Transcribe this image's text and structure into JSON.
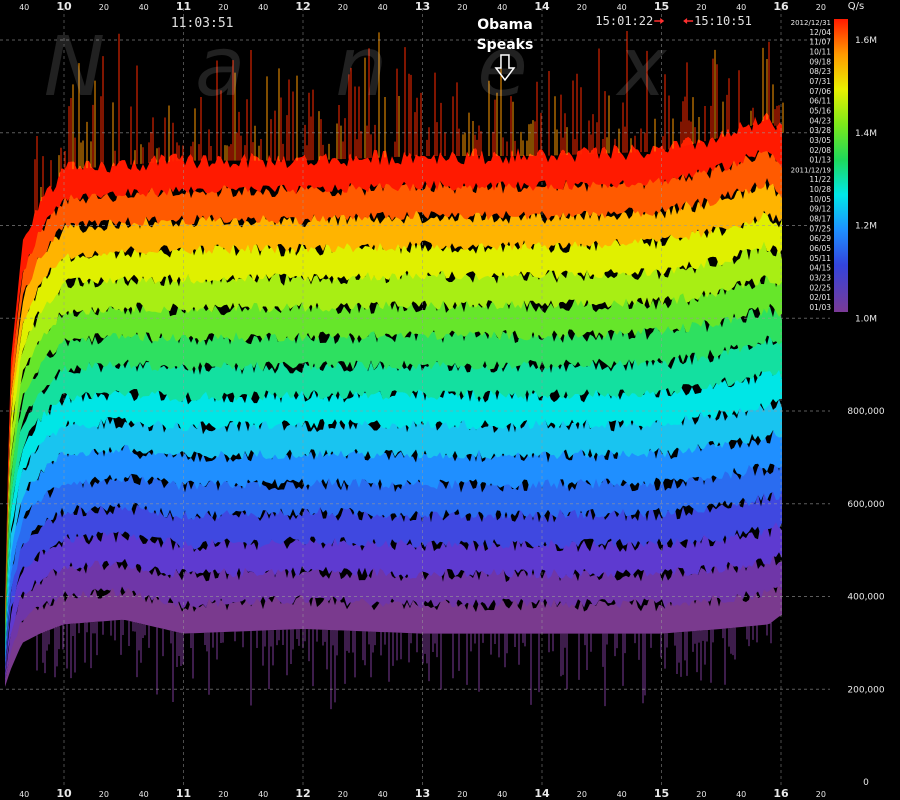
{
  "chart_data": {
    "type": "area",
    "title": "",
    "xlabel": "",
    "ylabel": "",
    "y_unit": "Q/s",
    "watermark": "Nanex",
    "xlim": [
      9.5,
      16.5
    ],
    "ylim": [
      0,
      1700000
    ],
    "hour_ticks": [
      {
        "value": 10,
        "label": "10"
      },
      {
        "value": 11,
        "label": "11"
      },
      {
        "value": 12,
        "label": "12"
      },
      {
        "value": 13,
        "label": "13"
      },
      {
        "value": 14,
        "label": "14"
      },
      {
        "value": 15,
        "label": "15"
      },
      {
        "value": 16,
        "label": "16"
      }
    ],
    "minute_ticks": [
      {
        "value": 9.6667,
        "label": "40"
      },
      {
        "value": 10.3333,
        "label": "20"
      },
      {
        "value": 10.6667,
        "label": "40"
      },
      {
        "value": 11.3333,
        "label": "20"
      },
      {
        "value": 11.6667,
        "label": "40"
      },
      {
        "value": 12.3333,
        "label": "20"
      },
      {
        "value": 12.6667,
        "label": "40"
      },
      {
        "value": 13.3333,
        "label": "20"
      },
      {
        "value": 13.6667,
        "label": "40"
      },
      {
        "value": 14.3333,
        "label": "20"
      },
      {
        "value": 14.6667,
        "label": "40"
      },
      {
        "value": 15.3333,
        "label": "20"
      },
      {
        "value": 15.6667,
        "label": "40"
      },
      {
        "value": 16.3333,
        "label": "20"
      }
    ],
    "y_ticks": [
      {
        "value": 1600000,
        "label": "1.6M"
      },
      {
        "value": 1400000,
        "label": "1.4M"
      },
      {
        "value": 1200000,
        "label": "1.2M"
      },
      {
        "value": 1000000,
        "label": "1.0M"
      },
      {
        "value": 800000,
        "label": "800,000"
      },
      {
        "value": 600000,
        "label": "600,000"
      },
      {
        "value": 400000,
        "label": "400,000"
      },
      {
        "value": 200000,
        "label": "200,000"
      },
      {
        "value": 0,
        "label": "0"
      }
    ],
    "series_dates": [
      "2012/12/31",
      "12/04",
      "11/07",
      "10/11",
      "09/18",
      "08/23",
      "07/31",
      "07/06",
      "06/11",
      "05/16",
      "04/23",
      "03/28",
      "03/05",
      "02/08",
      "01/13",
      "2011/12/19",
      "11/22",
      "10/28",
      "10/05",
      "09/12",
      "08/17",
      "07/25",
      "06/29",
      "06/05",
      "05/11",
      "04/15",
      "03/23",
      "02/25",
      "02/01",
      "01/03"
    ],
    "band_profile": {
      "time": [
        9.5,
        9.55,
        9.65,
        9.8,
        10.0,
        10.5,
        11.0,
        12.0,
        13.0,
        14.0,
        15.0,
        15.5,
        15.9,
        16.0
      ],
      "top_quantity": [
        300000,
        900000,
        1150000,
        1250000,
        1320000,
        1330000,
        1340000,
        1340000,
        1350000,
        1350000,
        1360000,
        1390000,
        1430000,
        1400000
      ],
      "bottom_quantity": [
        200000,
        240000,
        300000,
        320000,
        340000,
        350000,
        320000,
        330000,
        320000,
        320000,
        320000,
        330000,
        340000,
        360000
      ]
    },
    "annotations": [
      {
        "id": "t1",
        "time": 11.0642,
        "text": "11:03:51"
      },
      {
        "id": "obama",
        "time": 13.69,
        "text_line1": "Obama",
        "text_line2": "Speaks"
      },
      {
        "id": "t2",
        "time": 15.0228,
        "text": "15:01:22"
      },
      {
        "id": "t3",
        "time": 15.1808,
        "text": "15:10:51"
      }
    ],
    "grid": true,
    "legend_position": "right"
  }
}
